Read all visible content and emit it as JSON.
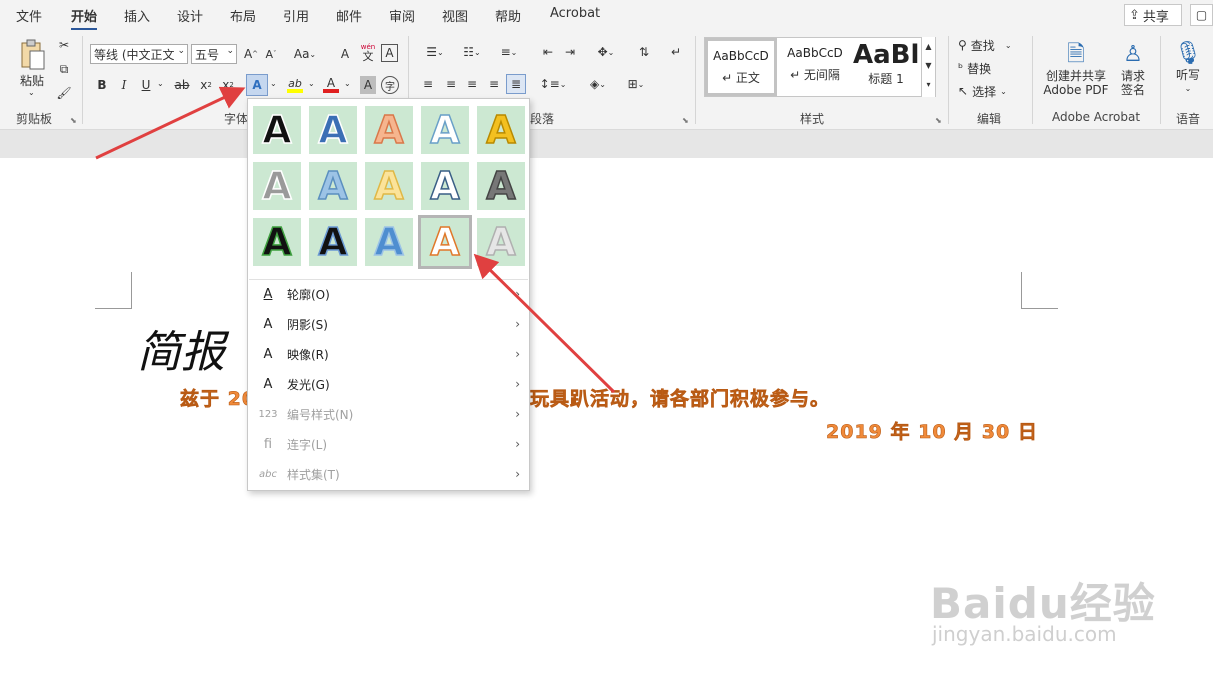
{
  "tabs": [
    "文件",
    "开始",
    "插入",
    "设计",
    "布局",
    "引用",
    "邮件",
    "审阅",
    "视图",
    "帮助",
    "Acrobat"
  ],
  "active_tab": "开始",
  "share_label": "共享",
  "ribbon": {
    "clipboard": {
      "paste_label": "粘贴",
      "group_label": "剪贴板"
    },
    "font": {
      "font_name": "等线 (中文正文",
      "font_size": "五号",
      "grow": "A",
      "shrink": "A",
      "case": "Aa",
      "clear_icon": "A",
      "pinyin_top": "wén",
      "pinyin_bottom": "文",
      "border_char": "A",
      "bold": "B",
      "italic": "I",
      "underline": "U",
      "strike": "ab",
      "sub": "x",
      "sup": "x",
      "effects": "A",
      "highlight": "ab",
      "color": "A",
      "shading": "A",
      "enclose": "字",
      "group_label": "字体"
    },
    "paragraph": {
      "group_label": "段落"
    },
    "styles": {
      "items": [
        {
          "sample": "AaBbCcD",
          "name": "↵ 正文"
        },
        {
          "sample": "AaBbCcD",
          "name": "↵ 无间隔"
        },
        {
          "sample": "AaBl",
          "name": "标题 1"
        }
      ],
      "group_label": "样式"
    },
    "editing": {
      "find": "查找",
      "replace": "替换",
      "select": "选择",
      "group_label": "编辑"
    },
    "acrobat": {
      "create_line1": "创建并共享",
      "create_line2": "Adobe PDF",
      "sign_line1": "请求",
      "sign_line2": "签名",
      "group_label": "Adobe Acrobat"
    },
    "voice": {
      "dictate": "听写",
      "group_label": "语音"
    }
  },
  "document": {
    "title": "简报",
    "line1_start": "兹于 20",
    "line1_end": "玩具趴活动，请各部门积极参与。",
    "date": "2019 年 10 月 30 日"
  },
  "dropdown": {
    "swatches": [
      {
        "fill": "#111111",
        "stroke": "#ffffff"
      },
      {
        "fill": "#3b6fb5",
        "stroke": "#ffffff"
      },
      {
        "fill": "#f6b58e",
        "stroke": "#d9784a"
      },
      {
        "fill": "#ffffff",
        "stroke": "#6aa0c8"
      },
      {
        "fill": "#f3c020",
        "stroke": "#b88a00"
      },
      {
        "fill": "#9a9a9a",
        "stroke": "#ffffff"
      },
      {
        "fill": "#9cc3e6",
        "stroke": "#5b8fbf"
      },
      {
        "fill": "#fbe39a",
        "stroke": "#e0b846"
      },
      {
        "fill": "#ffffff",
        "stroke": "#3a5f86"
      },
      {
        "fill": "#777777",
        "stroke": "#444444"
      },
      {
        "fill": "#111111",
        "stroke": "#3fa040"
      },
      {
        "fill": "#111111",
        "stroke": "#6b9ad4"
      },
      {
        "fill": "#4f8ed0",
        "stroke": "#9cc3e6"
      },
      {
        "fill": "#ffffff",
        "stroke": "#e0782a"
      },
      {
        "fill": "#e6e6e6",
        "stroke": "#b0b0b0"
      }
    ],
    "selected_index": 13,
    "menu": [
      {
        "icon": "A",
        "label": "轮廓(O)",
        "disabled": false
      },
      {
        "icon": "A",
        "label": "阴影(S)",
        "disabled": false
      },
      {
        "icon": "A",
        "label": "映像(R)",
        "disabled": false
      },
      {
        "icon": "A",
        "label": "发光(G)",
        "disabled": false
      },
      {
        "icon": "123",
        "label": "编号样式(N)",
        "disabled": true
      },
      {
        "icon": "fi",
        "label": "连字(L)",
        "disabled": true
      },
      {
        "icon": "abc",
        "label": "样式集(T)",
        "disabled": true
      }
    ]
  },
  "watermark": {
    "main": "Baidu经验",
    "sub": "jingyan.baidu.com"
  },
  "colors": {
    "accent": "#2b579a",
    "arrow": "#e04040",
    "wordart_orange": "#f08a3a"
  }
}
